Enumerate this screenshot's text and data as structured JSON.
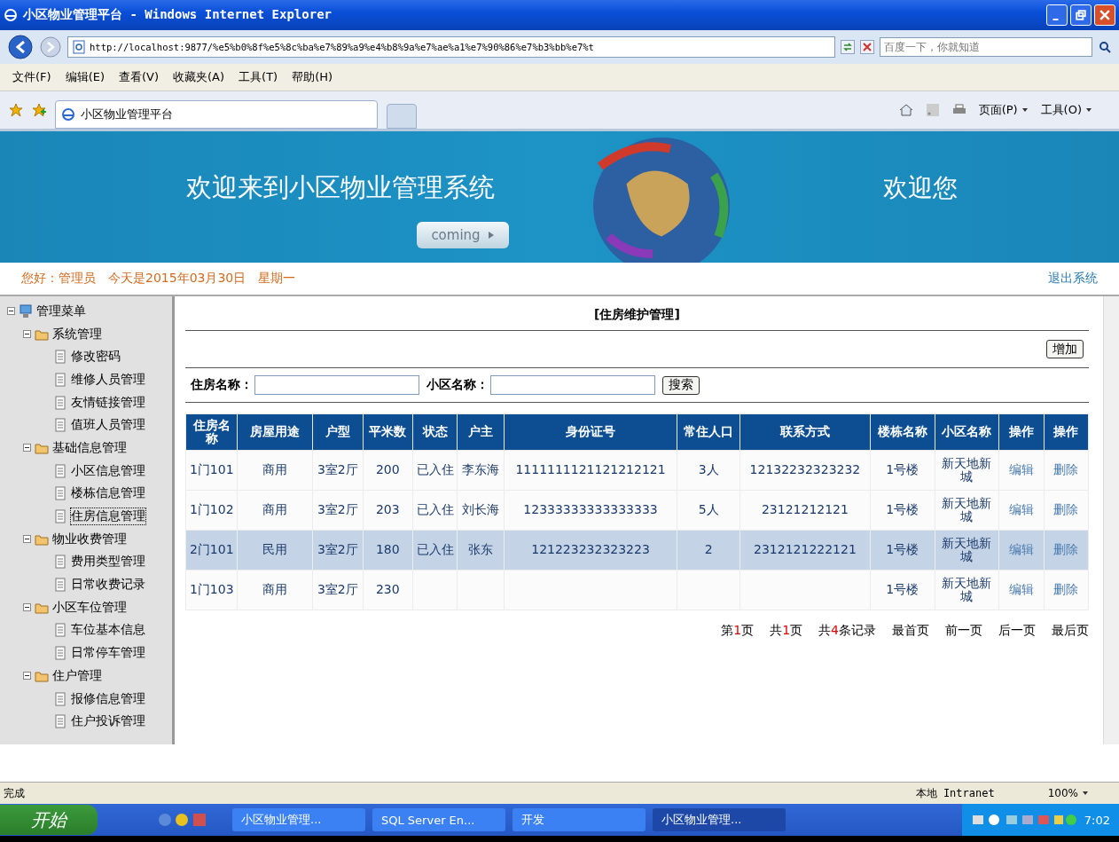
{
  "window": {
    "title": "小区物业管理平台 - Windows Internet Explorer"
  },
  "address_bar": {
    "url": "http://localhost:9877/%e5%b0%8f%e5%8c%ba%e7%89%a9%e4%b8%9a%e7%ae%a1%e7%90%86%e7%b3%bb%e7%t",
    "search_placeholder": "百度一下，你就知道"
  },
  "menu_bar": [
    "文件(F)",
    "编辑(E)",
    "查看(V)",
    "收藏夹(A)",
    "工具(T)",
    "帮助(H)"
  ],
  "tab": {
    "title": "小区物业管理平台"
  },
  "command_bar": [
    "页面(P)",
    "工具(O)"
  ],
  "banner": {
    "heading": "欢迎来到小区物业管理系统",
    "button": "coming",
    "welcome": "欢迎您"
  },
  "greeting": {
    "text": "您好：管理员　今天是2015年03月30日　星期一",
    "logout": "退出系统"
  },
  "sidebar": {
    "root": "管理菜单",
    "expanded": true,
    "groups": [
      {
        "label": "系统管理",
        "expanded": true,
        "children": [
          {
            "label": "修改密码",
            "selected": false
          },
          {
            "label": "维修人员管理",
            "selected": false
          },
          {
            "label": "友情链接管理",
            "selected": false
          },
          {
            "label": "值班人员管理",
            "selected": false
          }
        ]
      },
      {
        "label": "基础信息管理",
        "expanded": true,
        "children": [
          {
            "label": "小区信息管理",
            "selected": false
          },
          {
            "label": "楼栋信息管理",
            "selected": false
          },
          {
            "label": "住房信息管理",
            "selected": true
          }
        ]
      },
      {
        "label": "物业收费管理",
        "expanded": true,
        "children": [
          {
            "label": "费用类型管理",
            "selected": false
          },
          {
            "label": "日常收费记录",
            "selected": false
          }
        ]
      },
      {
        "label": "小区车位管理",
        "expanded": true,
        "children": [
          {
            "label": "车位基本信息",
            "selected": false
          },
          {
            "label": "日常停车管理",
            "selected": false
          }
        ]
      },
      {
        "label": "住户管理",
        "expanded": true,
        "children": [
          {
            "label": "报修信息管理",
            "selected": false
          },
          {
            "label": "住户投诉管理",
            "selected": false
          }
        ]
      }
    ]
  },
  "content": {
    "title": "[住房维护管理]",
    "add_button": "增加",
    "search": [
      {
        "label": "住房名称："
      },
      {
        "label": "小区名称："
      }
    ],
    "search_button": "搜索",
    "table": {
      "columns": [
        "住房名称",
        "房屋用途",
        "户型",
        "平米数",
        "状态",
        "户主",
        "身份证号",
        "常住人口",
        "联系方式",
        "楼栋名称",
        "小区名称",
        "操作",
        "操作"
      ],
      "rows": [
        {
          "selected": false,
          "cells": [
            "1门101",
            "商用",
            "3室2厅",
            "200",
            "已入住",
            "李东海",
            "1111111121121212121",
            "3人",
            "12132232323232",
            "1号楼",
            "新天地新城"
          ],
          "actions": [
            "编辑",
            "删除"
          ]
        },
        {
          "selected": false,
          "cells": [
            "1门102",
            "商用",
            "3室2厅",
            "203",
            "已入住",
            "刘长海",
            "12333333333333333",
            "5人",
            "23121212121",
            "1号楼",
            "新天地新城"
          ],
          "actions": [
            "编辑",
            "删除"
          ]
        },
        {
          "selected": true,
          "cells": [
            "2门101",
            "民用",
            "3室2厅",
            "180",
            "已入住",
            "张东",
            "121223232323223",
            "2",
            "2312121222121",
            "1号楼",
            "新天地新城"
          ],
          "actions": [
            "编辑",
            "删除"
          ]
        },
        {
          "selected": false,
          "cells": [
            "1门103",
            "商用",
            "3室2厅",
            "230",
            "",
            "",
            "",
            "",
            "",
            "1号楼",
            "新天地新城"
          ],
          "actions": [
            "编辑",
            "删除"
          ]
        }
      ]
    },
    "pager": {
      "info": [
        {
          "pre": "第",
          "num": "1",
          "post": "页"
        },
        {
          "pre": "共",
          "num": "1",
          "post": "页"
        },
        {
          "pre": "共",
          "num": "4",
          "post": "条记录"
        }
      ],
      "links": [
        "最首页",
        "前一页",
        "后一页",
        "最后页"
      ]
    }
  },
  "status_bar": {
    "text": "完成",
    "zone": "本地 Intranet",
    "zoom": "100%"
  },
  "taskbar": {
    "start": "开始",
    "buttons": [
      {
        "label": "小区物业管理...",
        "selected": false
      },
      {
        "label": "SQL Server En...",
        "selected": false
      },
      {
        "label": "开发",
        "selected": false
      },
      {
        "label": "小区物业管理...",
        "selected": true
      }
    ],
    "clock": "7:02"
  }
}
